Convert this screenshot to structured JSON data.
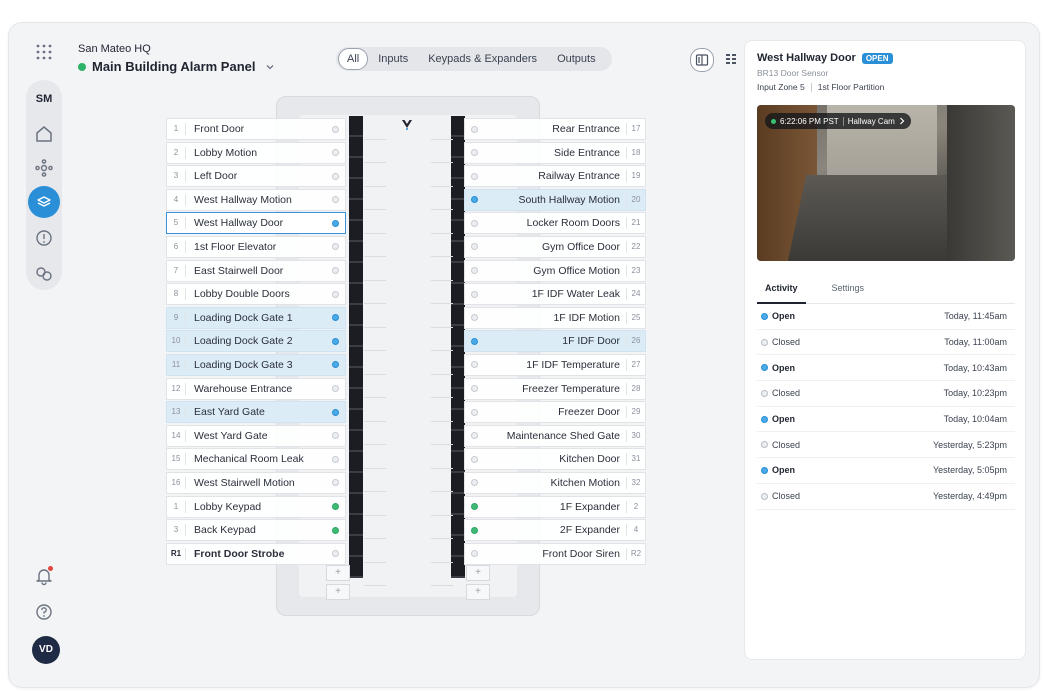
{
  "header": {
    "site_name": "San Mateo HQ",
    "panel_name": "Main Building Alarm Panel",
    "status_color": "#2fb36a"
  },
  "rail": {
    "site_badge": "SM",
    "avatar_initials": "VD",
    "active_color": "#2a8fd6"
  },
  "filters": [
    {
      "label": "All",
      "active": true
    },
    {
      "label": "Inputs",
      "active": false
    },
    {
      "label": "Keypads & Expanders",
      "active": false
    },
    {
      "label": "Outputs",
      "active": false
    }
  ],
  "left_zones": [
    {
      "num": "1",
      "name": "Front Door",
      "state": "none"
    },
    {
      "num": "2",
      "name": "Lobby Motion",
      "state": "none"
    },
    {
      "num": "3",
      "name": "Left Door",
      "state": "none"
    },
    {
      "num": "4",
      "name": "West Hallway Motion",
      "state": "none"
    },
    {
      "num": "5",
      "name": "West Hallway Door",
      "state": "selected"
    },
    {
      "num": "6",
      "name": "1st Floor Elevator",
      "state": "none"
    },
    {
      "num": "7",
      "name": "East Stairwell Door",
      "state": "none"
    },
    {
      "num": "8",
      "name": "Lobby Double Doors",
      "state": "none"
    },
    {
      "num": "9",
      "name": "Loading Dock Gate 1",
      "state": "open"
    },
    {
      "num": "10",
      "name": "Loading Dock Gate 2",
      "state": "open"
    },
    {
      "num": "11",
      "name": "Loading Dock Gate 3",
      "state": "open"
    },
    {
      "num": "12",
      "name": "Warehouse Entrance",
      "state": "none"
    },
    {
      "num": "13",
      "name": "East Yard Gate",
      "state": "open"
    },
    {
      "num": "14",
      "name": "West Yard Gate",
      "state": "none"
    },
    {
      "num": "15",
      "name": "Mechanical Room Leak",
      "state": "none"
    },
    {
      "num": "16",
      "name": "West Stairwell Motion",
      "state": "none"
    },
    {
      "num": "1",
      "name": "Lobby Keypad",
      "state": "ok"
    },
    {
      "num": "3",
      "name": "Back Keypad",
      "state": "ok"
    },
    {
      "num": "R1",
      "name": "Front Door Strobe",
      "state": "bold"
    }
  ],
  "right_zones": [
    {
      "num": "17",
      "name": "Rear Entrance",
      "state": "none"
    },
    {
      "num": "18",
      "name": "Side Entrance",
      "state": "none"
    },
    {
      "num": "19",
      "name": "Railway Entrance",
      "state": "none"
    },
    {
      "num": "20",
      "name": "South Hallway Motion",
      "state": "open"
    },
    {
      "num": "21",
      "name": "Locker Room Doors",
      "state": "none"
    },
    {
      "num": "22",
      "name": "Gym Office Door",
      "state": "none"
    },
    {
      "num": "23",
      "name": "Gym Office Motion",
      "state": "none"
    },
    {
      "num": "24",
      "name": "1F IDF Water Leak",
      "state": "none"
    },
    {
      "num": "25",
      "name": "1F IDF Motion",
      "state": "none"
    },
    {
      "num": "26",
      "name": "1F IDF Door",
      "state": "open"
    },
    {
      "num": "27",
      "name": "1F IDF Temperature",
      "state": "none"
    },
    {
      "num": "28",
      "name": "Freezer Temperature",
      "state": "none"
    },
    {
      "num": "29",
      "name": "Freezer Door",
      "state": "none"
    },
    {
      "num": "30",
      "name": "Maintenance Shed Gate",
      "state": "none"
    },
    {
      "num": "31",
      "name": "Kitchen Door",
      "state": "none"
    },
    {
      "num": "32",
      "name": "Kitchen Motion",
      "state": "none"
    },
    {
      "num": "2",
      "name": "1F Expander",
      "state": "ok"
    },
    {
      "num": "4",
      "name": "2F Expander",
      "state": "ok"
    },
    {
      "num": "R2",
      "name": "Front Door Siren",
      "state": "none"
    }
  ],
  "details": {
    "title": "West Hallway Door",
    "badge": "OPEN",
    "subtitle": "BR13 Door Sensor",
    "input_zone": "Input Zone 5",
    "partition": "1st Floor Partition",
    "camera_time": "6:22:06 PM PST",
    "camera_name": "Hallway Cam",
    "tabs": [
      {
        "label": "Activity",
        "active": true
      },
      {
        "label": "Settings",
        "active": false
      }
    ],
    "activity": [
      {
        "status": "Open",
        "kind": "open",
        "time": "Today, 11:45am"
      },
      {
        "status": "Closed",
        "kind": "closed",
        "time": "Today, 11:00am"
      },
      {
        "status": "Open",
        "kind": "open",
        "time": "Today, 10:43am"
      },
      {
        "status": "Closed",
        "kind": "closed",
        "time": "Today, 10:23pm"
      },
      {
        "status": "Open",
        "kind": "open",
        "time": "Today, 10:04am"
      },
      {
        "status": "Closed",
        "kind": "closed",
        "time": "Yesterday, 5:23pm"
      },
      {
        "status": "Open",
        "kind": "open",
        "time": "Yesterday, 5:05pm"
      },
      {
        "status": "Closed",
        "kind": "closed",
        "time": "Yesterday, 4:49pm"
      }
    ]
  }
}
